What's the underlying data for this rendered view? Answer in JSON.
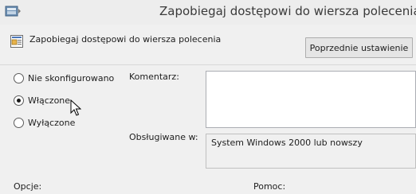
{
  "window": {
    "title": "Zapobiegaj dostępowi do wiersza polecenia"
  },
  "header": {
    "policy_name": "Zapobiegaj dostępowi do wiersza polecenia",
    "previous_setting_label": "Poprzednie ustawienie"
  },
  "options": [
    {
      "label": "Nie skonfigurowano",
      "checked": false
    },
    {
      "label": "Włączone",
      "checked": true
    },
    {
      "label": "Wyłączone",
      "checked": false
    }
  ],
  "comment": {
    "label": "Komentarz:",
    "value": ""
  },
  "supported": {
    "label": "Obsługiwane w:",
    "value": "System Windows 2000 lub nowszy"
  },
  "sections": {
    "options_label": "Opcje:",
    "help_label": "Pomoc:"
  },
  "icons": {
    "app": "policy-app-icon",
    "policy": "policy-setting-icon",
    "cursor": "mouse-pointer-icon"
  }
}
